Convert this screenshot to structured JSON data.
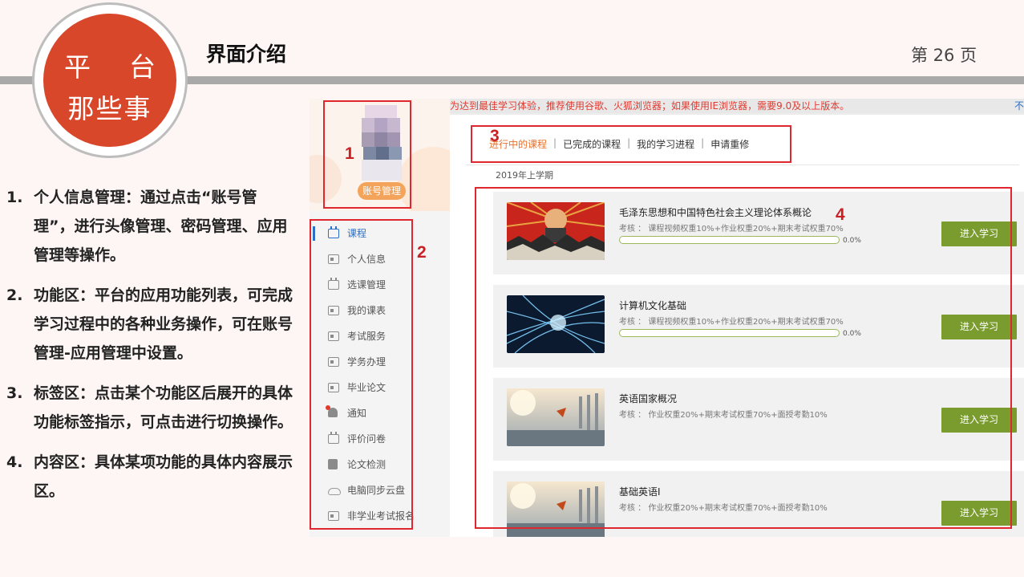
{
  "header": {
    "logo_line1_left": "平",
    "logo_line1_right": "台",
    "logo_line2": "那些事",
    "title": "界面介绍",
    "page_label": "第 26 页"
  },
  "descriptions": [
    {
      "num": "1.",
      "text": "个人信息管理：通过点击“账号管理”，进行头像管理、密码管理、应用管理等操作。"
    },
    {
      "num": "2.",
      "text": "功能区：平台的应用功能列表，可完成学习过程中的各种业务操作，可在账号管理-应用管理中设置。"
    },
    {
      "num": "3.",
      "text": "标签区：点击某个功能区后展开的具体功能标签指示，可点击进行切换操作。"
    },
    {
      "num": "4.",
      "text": "内容区：具体某项功能的具体内容展示区。"
    }
  ],
  "screenshot": {
    "notice": "为达到最佳学习体验，推荐使用谷歌、火狐浏览器；如果使用IE浏览器，需要9.0及以上版本。",
    "notice_right": "不",
    "account_button": "账号管理",
    "menu": [
      {
        "label": "课程",
        "icon": "calendar-icon",
        "active": true
      },
      {
        "label": "个人信息",
        "icon": "id-card-icon"
      },
      {
        "label": "选课管理",
        "icon": "calendar-icon"
      },
      {
        "label": "我的课表",
        "icon": "id-card-icon"
      },
      {
        "label": "考试服务",
        "icon": "id-card-icon"
      },
      {
        "label": "学务办理",
        "icon": "id-card-icon"
      },
      {
        "label": "毕业论文",
        "icon": "id-card-icon"
      },
      {
        "label": "通知",
        "icon": "bell-icon"
      },
      {
        "label": "评价问卷",
        "icon": "calendar-icon"
      },
      {
        "label": "论文检测",
        "icon": "book-icon"
      },
      {
        "label": "电脑同步云盘",
        "icon": "cloud-icon"
      },
      {
        "label": "非学业考试报名",
        "icon": "id-card-icon"
      }
    ],
    "tabs": [
      "进行中的课程",
      "已完成的课程",
      "我的学习进程",
      "申请重修"
    ],
    "semester": "2019年上学期",
    "courses": [
      {
        "title": "毛泽东思想和中国特色社会主义理论体系概论",
        "exam": "考核 ： 课程视频权重10%+作业权重20%+期末考试权重70%",
        "progress": "0.0%",
        "has_progress": true,
        "button": "进入学习"
      },
      {
        "title": "计算机文化基础",
        "exam": "考核 ： 课程视频权重10%+作业权重20%+期末考试权重70%",
        "progress": "0.0%",
        "has_progress": true,
        "button": "进入学习"
      },
      {
        "title": "英语国家概况",
        "exam": "考核 ： 作业权重20%+期末考试权重70%+面授考勤10%",
        "has_progress": false,
        "button": "进入学习"
      },
      {
        "title": "基础英语Ⅰ",
        "exam": "考核 ： 作业权重20%+期末考试权重70%+面授考勤10%",
        "has_progress": false,
        "button": "进入学习"
      }
    ]
  },
  "annotations": [
    "1",
    "2",
    "3",
    "4"
  ],
  "colors": {
    "accent_red": "#d9472a",
    "annotation_red": "#e0262e",
    "button_green": "#7a9c2e",
    "tab_orange": "#e9702a"
  }
}
